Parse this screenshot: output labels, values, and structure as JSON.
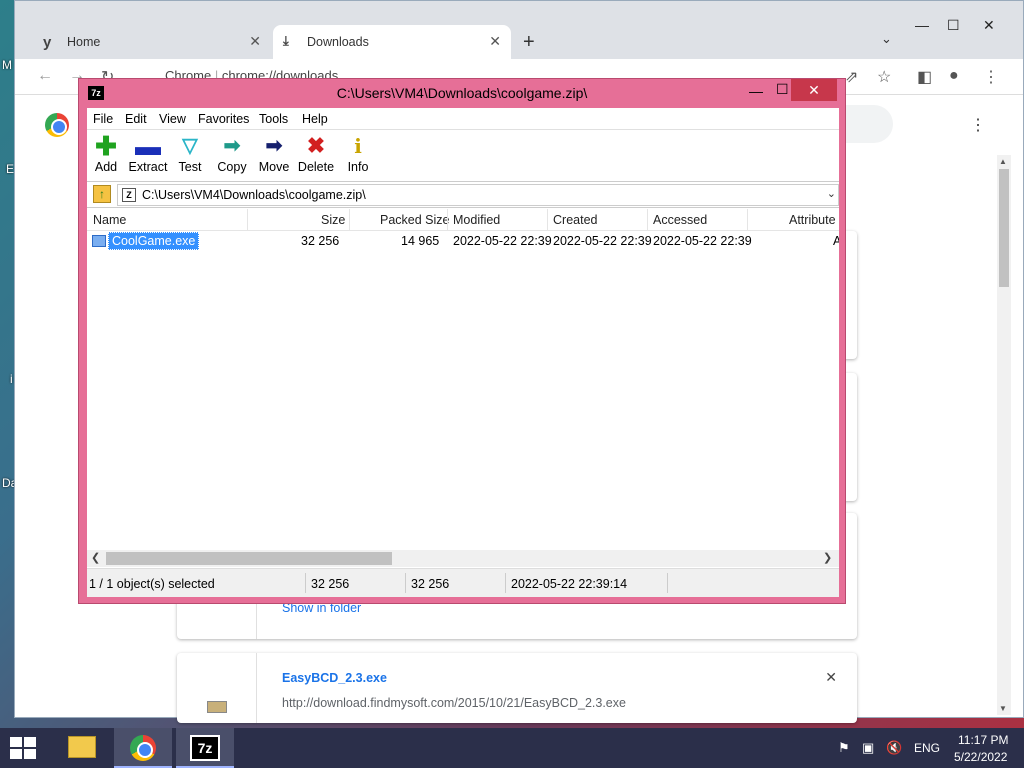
{
  "desktop": {
    "labels": [
      "M",
      "E",
      "i",
      "Da"
    ]
  },
  "chrome": {
    "tabs": [
      {
        "label": "Home",
        "icon": "y-logo-icon"
      },
      {
        "label": "Downloads",
        "icon": "download-icon"
      }
    ],
    "omnibox": {
      "site": "Chrome",
      "url": "chrome://downloads"
    },
    "downloads": [
      {
        "link": "Show in folder"
      },
      {
        "name": "EasyBCD_2.3.exe",
        "url": "http://download.findmysoft.com/2015/10/21/EasyBCD_2.3.exe"
      }
    ]
  },
  "zip": {
    "title": "C:\\Users\\VM4\\Downloads\\coolgame.zip\\",
    "menu": [
      "File",
      "Edit",
      "View",
      "Favorites",
      "Tools",
      "Help"
    ],
    "toolbar": [
      {
        "label": "Add",
        "icon": "add-icon",
        "color": "#1fa31f"
      },
      {
        "label": "Extract",
        "icon": "extract-icon",
        "color": "#1a2fb8"
      },
      {
        "label": "Test",
        "icon": "test-icon",
        "color": "#2bb5c8"
      },
      {
        "label": "Copy",
        "icon": "copy-icon",
        "color": "#1f9a8a"
      },
      {
        "label": "Move",
        "icon": "move-icon",
        "color": "#16206e"
      },
      {
        "label": "Delete",
        "icon": "delete-icon",
        "color": "#d21f1f"
      },
      {
        "label": "Info",
        "icon": "info-icon",
        "color": "#c8a400"
      }
    ],
    "address": "C:\\Users\\VM4\\Downloads\\coolgame.zip\\",
    "columns": [
      "Name",
      "Size",
      "Packed Size",
      "Modified",
      "Created",
      "Accessed",
      "Attribute"
    ],
    "rows": [
      {
        "name": "CoolGame.exe",
        "size": "32 256",
        "packed": "14 965",
        "modified": "2022-05-22 22:39",
        "created": "2022-05-22 22:39",
        "accessed": "2022-05-22 22:39",
        "attr": "A"
      }
    ],
    "status": {
      "selection": "1 / 1 object(s) selected",
      "size": "32 256",
      "packed": "32 256",
      "time": "2022-05-22 22:39:14"
    }
  },
  "taskbar": {
    "lang": "ENG",
    "time": "11:17 PM",
    "date": "5/22/2022"
  },
  "colors": {
    "zip_frame": "#e66f97",
    "zip_close": "#c7374b",
    "selection": "#3390ff",
    "taskbar": "#2b2f4a"
  }
}
